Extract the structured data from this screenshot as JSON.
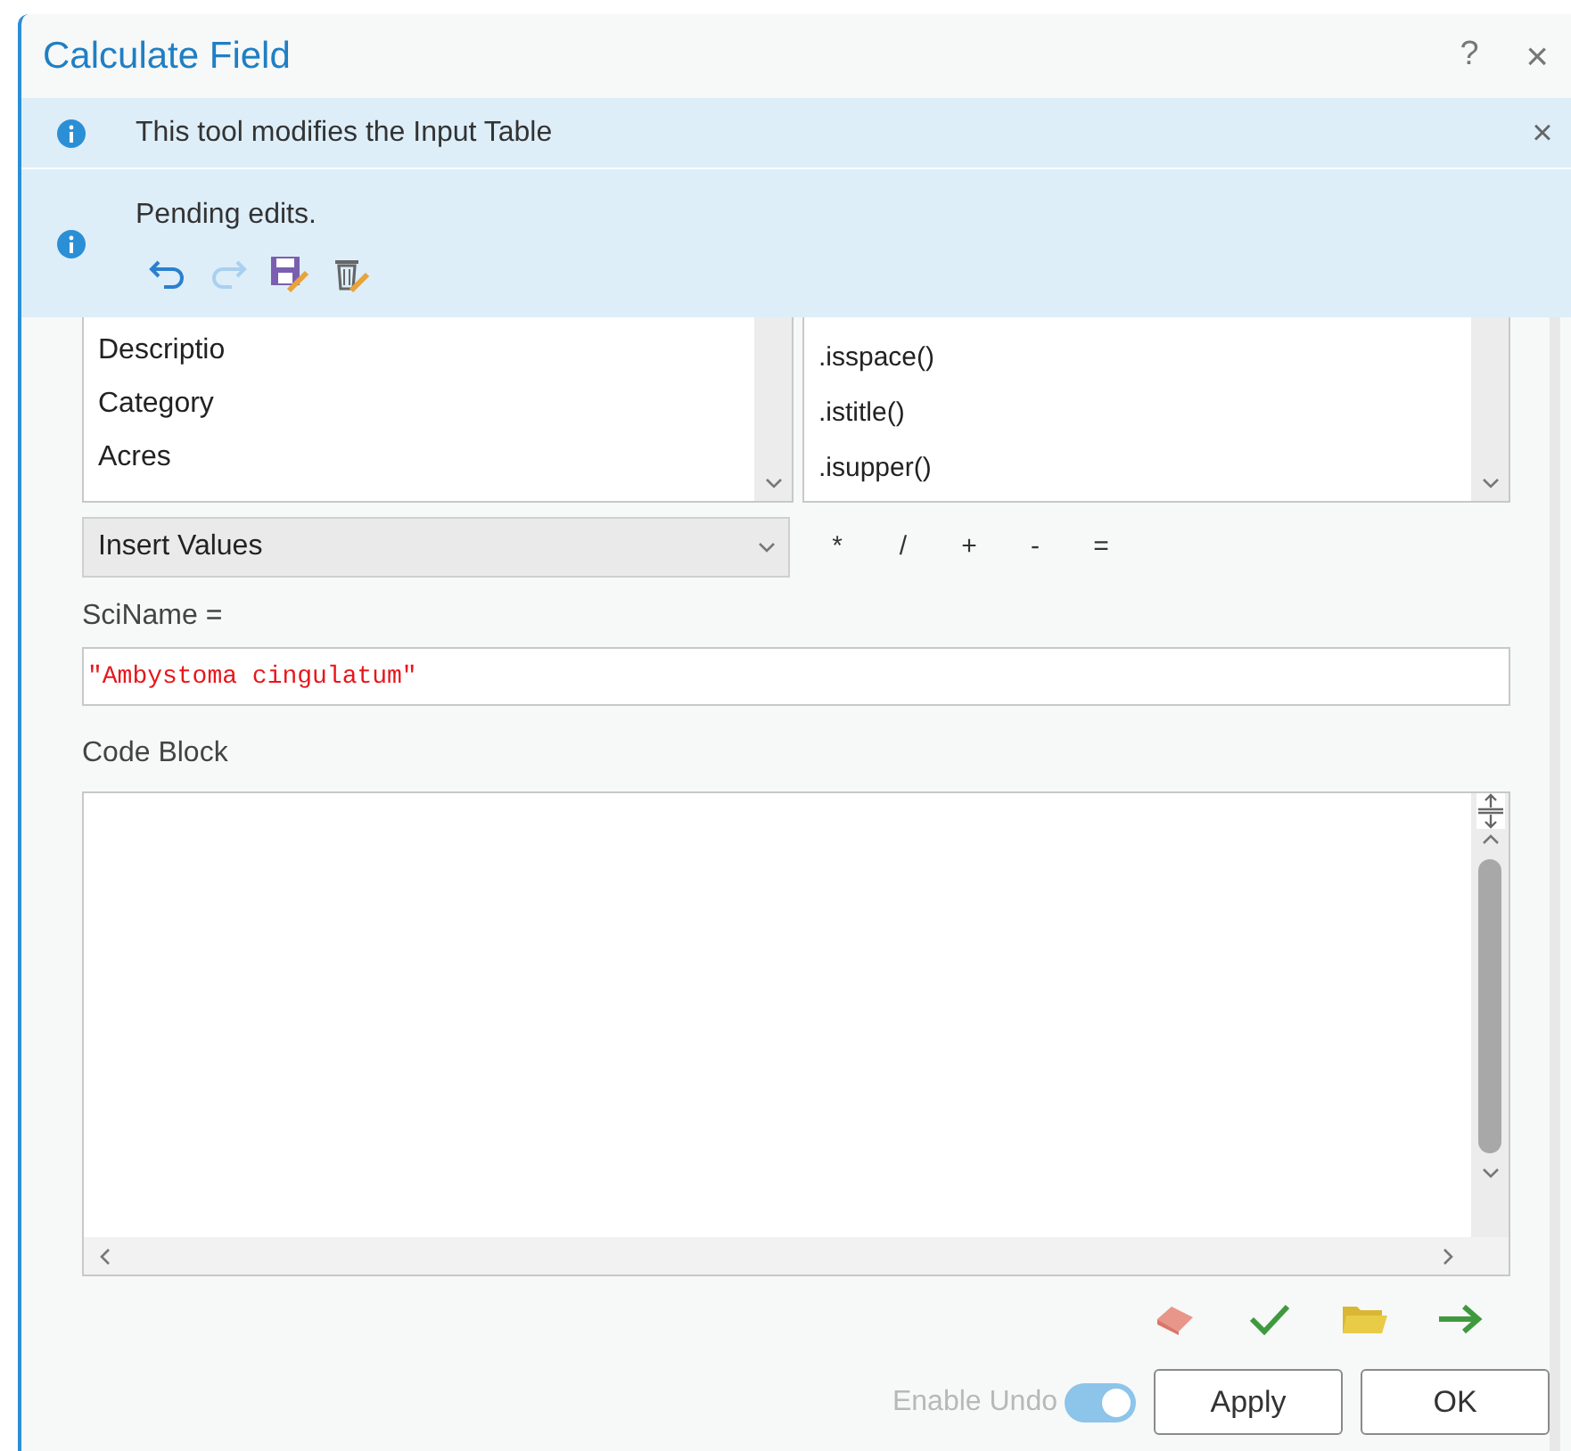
{
  "window": {
    "title": "Calculate Field",
    "help": "?",
    "close": "×"
  },
  "messages": [
    {
      "text": "This tool modifies the Input Table",
      "dismiss": "×"
    },
    {
      "text": "Pending edits."
    }
  ],
  "fields_list": {
    "items": [
      "Descriptio",
      "Category",
      "Acres"
    ]
  },
  "helpers_list": {
    "items": [
      ".isspace()",
      ".istitle()",
      ".isupper()"
    ]
  },
  "insert_dropdown": {
    "value": "Insert Values"
  },
  "operators": [
    "*",
    "/",
    "+",
    "-",
    "="
  ],
  "expression": {
    "label": "SciName =",
    "value": "\"Ambystoma cingulatum\""
  },
  "code_block": {
    "label": "Code Block"
  },
  "enable_undo": {
    "label": "Enable Undo",
    "on": true,
    "disabled": true
  },
  "buttons": [
    "Apply",
    "OK"
  ]
}
